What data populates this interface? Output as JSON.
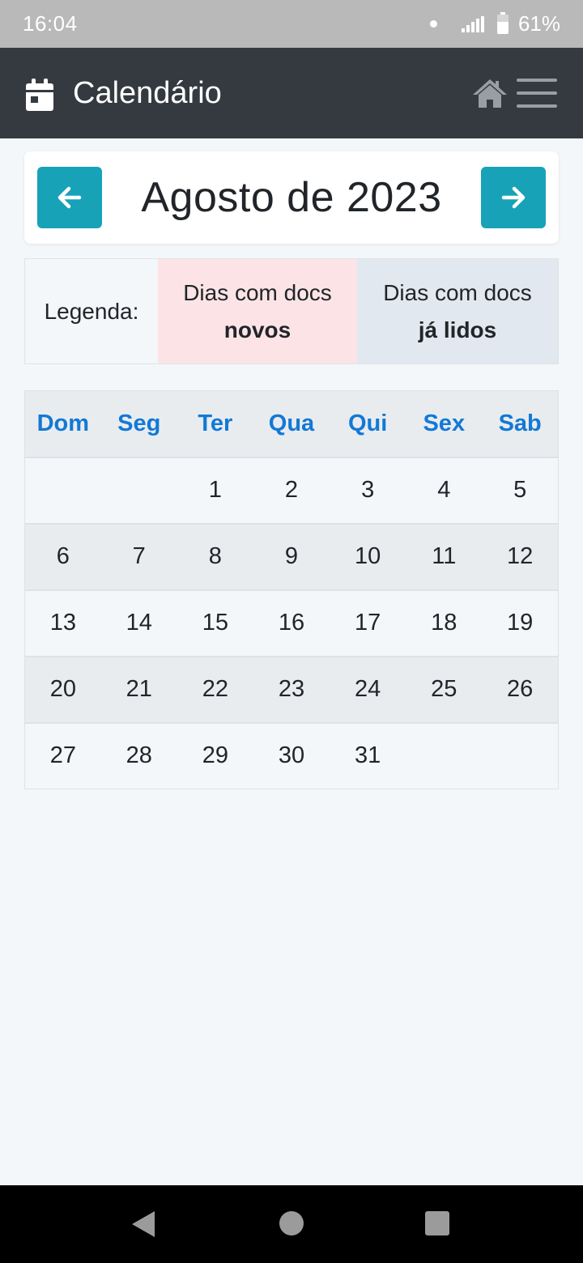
{
  "status_bar": {
    "time": "16:04",
    "battery": "61%",
    "icons": [
      "notification-dot-icon",
      "signal-icon",
      "battery-icon"
    ]
  },
  "navbar": {
    "icon": "calendar-icon",
    "title": "Calendário",
    "actions": [
      "home-icon",
      "menu-icon"
    ]
  },
  "month_header": {
    "title": "Agosto de 2023",
    "prev_icon": "arrow-left-icon",
    "next_icon": "arrow-right-icon"
  },
  "legend": {
    "label": "Legenda:",
    "new_line1": "Dias com docs",
    "new_line2": "novos",
    "read_line1": "Dias com docs",
    "read_line2": "já lidos",
    "colors": {
      "new": "#fce4e6",
      "read": "#e1e8ef"
    }
  },
  "calendar": {
    "weekdays": [
      "Dom",
      "Seg",
      "Ter",
      "Qua",
      "Qui",
      "Sex",
      "Sab"
    ],
    "weeks": [
      [
        "",
        "",
        "1",
        "2",
        "3",
        "4",
        "5"
      ],
      [
        "6",
        "7",
        "8",
        "9",
        "10",
        "11",
        "12"
      ],
      [
        "13",
        "14",
        "15",
        "16",
        "17",
        "18",
        "19"
      ],
      [
        "20",
        "21",
        "22",
        "23",
        "24",
        "25",
        "26"
      ],
      [
        "27",
        "28",
        "29",
        "30",
        "31",
        "",
        ""
      ]
    ]
  },
  "theme": {
    "accent": "#17a2b8",
    "navbar_bg": "#343a40",
    "weekday_color": "#1279d6"
  },
  "system_nav": [
    "back-icon",
    "home-circle-icon",
    "recents-icon"
  ]
}
